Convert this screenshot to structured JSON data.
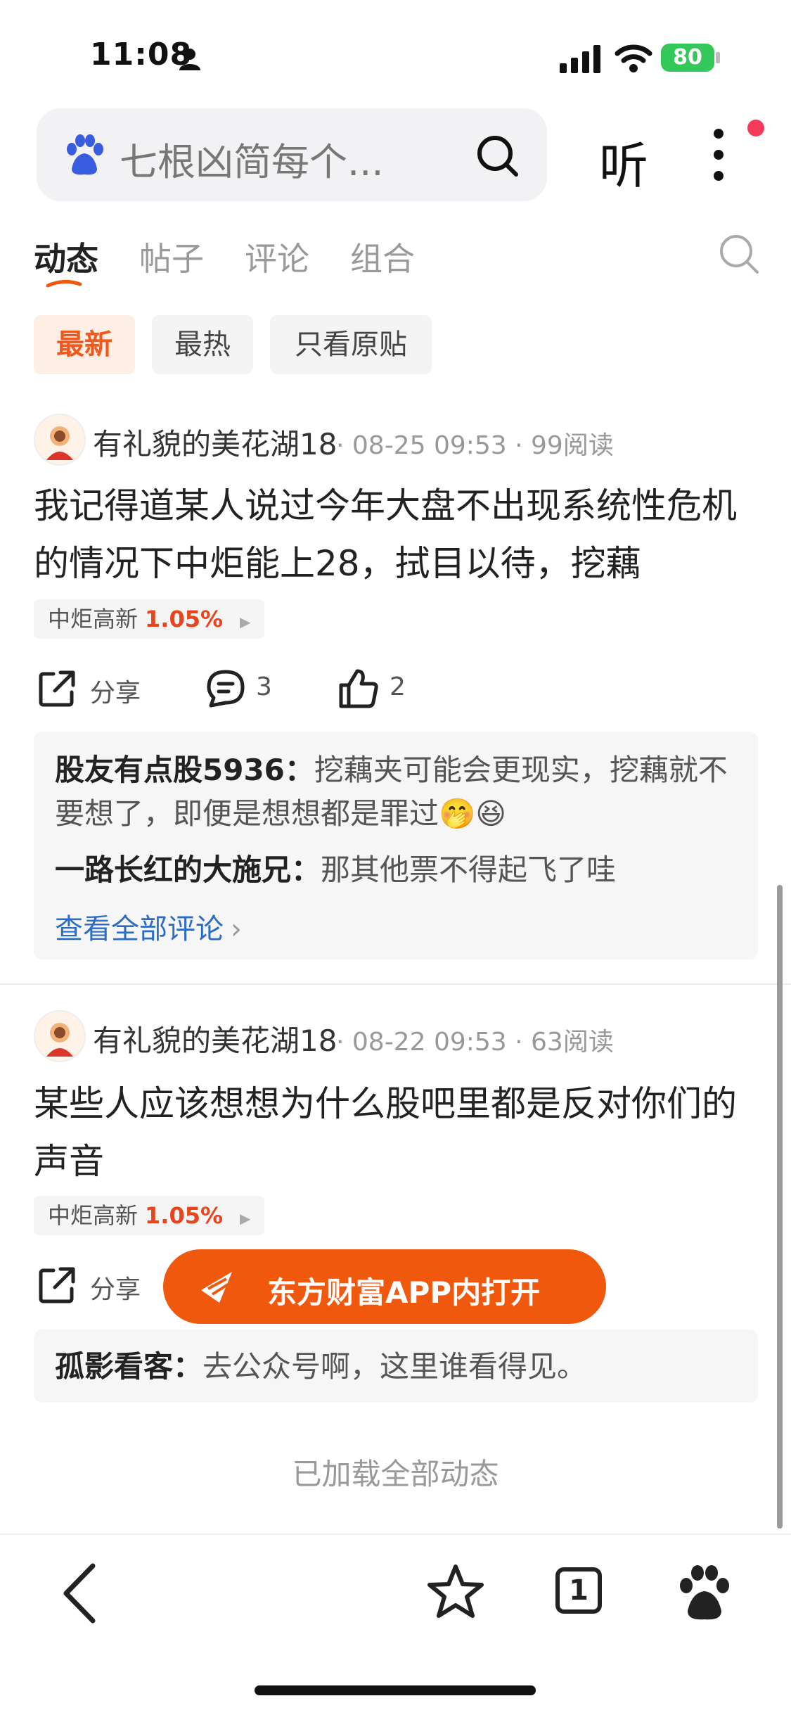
{
  "status_bar": {
    "time": "11:08",
    "battery": "80"
  },
  "search": {
    "query": "七根凶简每个...",
    "listen_label": "听"
  },
  "tabs": [
    {
      "label": "动态"
    },
    {
      "label": "帖子"
    },
    {
      "label": "评论"
    },
    {
      "label": "组合"
    }
  ],
  "filters": [
    {
      "label": "最新"
    },
    {
      "label": "最热"
    },
    {
      "label": "只看原贴"
    }
  ],
  "posts": [
    {
      "author": "有礼貌的美花湖18",
      "meta": "· 08-25 09:53 · 99阅读",
      "text": "我记得道某人说过今年大盘不出现系统性危机的情况下中炬能上28，拭目以待，挖藕",
      "stock": {
        "name": "中炬高新",
        "change": "1.05%"
      },
      "share_label": "分享",
      "comment_count": "3",
      "like_count": "2",
      "comments": [
        {
          "user": "股友有点股5936",
          "text": "挖藕夹可能会更现实，挖藕就不要想了，即便是想想都是罪过🤭😆"
        },
        {
          "user": "一路长红的大施兄",
          "text": "那其他票不得起飞了哇"
        }
      ],
      "view_all": "查看全部评论"
    },
    {
      "author": "有礼貌的美花湖18",
      "meta": "· 08-22 09:53 · 63阅读",
      "text": "某些人应该想想为什么股吧里都是反对你们的声音",
      "stock": {
        "name": "中炬高新",
        "change": "1.05%"
      },
      "share_label": "分享",
      "comments": [
        {
          "user": "孤影看客",
          "text": "去公众号啊，这里谁看得见。"
        }
      ]
    }
  ],
  "open_app_label": "东方财富APP内打开",
  "loaded_all": "已加载全部动态",
  "bottom_nav": {
    "tab_count": "1"
  },
  "colors": {
    "accent": "#f0580e",
    "up": "#e8451e",
    "link": "#2b6cc4"
  }
}
